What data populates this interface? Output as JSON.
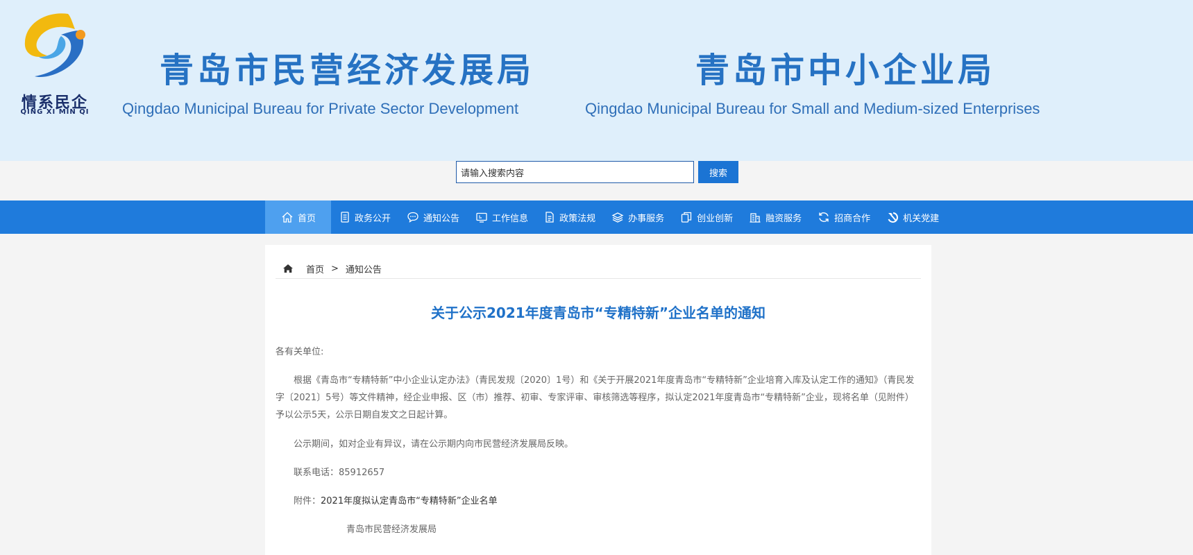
{
  "banner": {
    "logo_cn": "情系民企",
    "logo_en": "QING XI MIN QI",
    "title1_cn": "青岛市民营经济发展局",
    "title1_en": "Qingdao Municipal Bureau for Private Sector Development",
    "title2_cn": "青岛市中小企业局",
    "title2_en": "Qingdao Municipal Bureau for Small and Medium-sized Enterprises"
  },
  "search": {
    "value": "请输入搜索内容",
    "button": "搜索"
  },
  "nav": {
    "items": [
      {
        "label": "首页",
        "icon": "home-icon",
        "active": true
      },
      {
        "label": "政务公开",
        "icon": "document-icon"
      },
      {
        "label": "通知公告",
        "icon": "chat-bubble-icon"
      },
      {
        "label": "工作信息",
        "icon": "monitor-icon"
      },
      {
        "label": "政策法规",
        "icon": "file-list-icon"
      },
      {
        "label": "办事服务",
        "icon": "layers-icon"
      },
      {
        "label": "创业创新",
        "icon": "copy-icon"
      },
      {
        "label": "融资服务",
        "icon": "building-icon"
      },
      {
        "label": "招商合作",
        "icon": "refresh-icon"
      },
      {
        "label": "机关党建",
        "icon": "hammer-sickle-icon"
      }
    ]
  },
  "breadcrumb": {
    "home": "首页",
    "separator": ">",
    "current": "通知公告"
  },
  "article": {
    "title": "关于公示2021年度青岛市“专精特新”企业名单的通知",
    "salutation": "各有关单位:",
    "para1": "根据《青岛市“专精特新”中小企业认定办法》（青民发规〔2020〕1号）和《关于开展2021年度青岛市“专精特新”企业培育入库及认定工作的通知》（青民发字〔2021〕5号）等文件精神，经企业申报、区（市）推荐、初审、专家评审、审核筛选等程序，拟认定2021年度青岛市“专精特新”企业，现将名单（见附件）予以公示5天，公示日期自发文之日起计算。",
    "para2": "公示期间，如对企业有异议，请在公示期内向市民营经济发展局反映。",
    "para3": "联系电话：85912657",
    "attachment_label": "附件：",
    "attachment_link": "2021年度拟认定青岛市“专精特新”企业名单",
    "signature": "青岛市民营经济发展局"
  },
  "colors": {
    "banner_bg": "#dfeffb",
    "nav_bg": "#1f7bdc",
    "nav_active": "#4ea0ef",
    "title_blue": "#1f71c8"
  }
}
